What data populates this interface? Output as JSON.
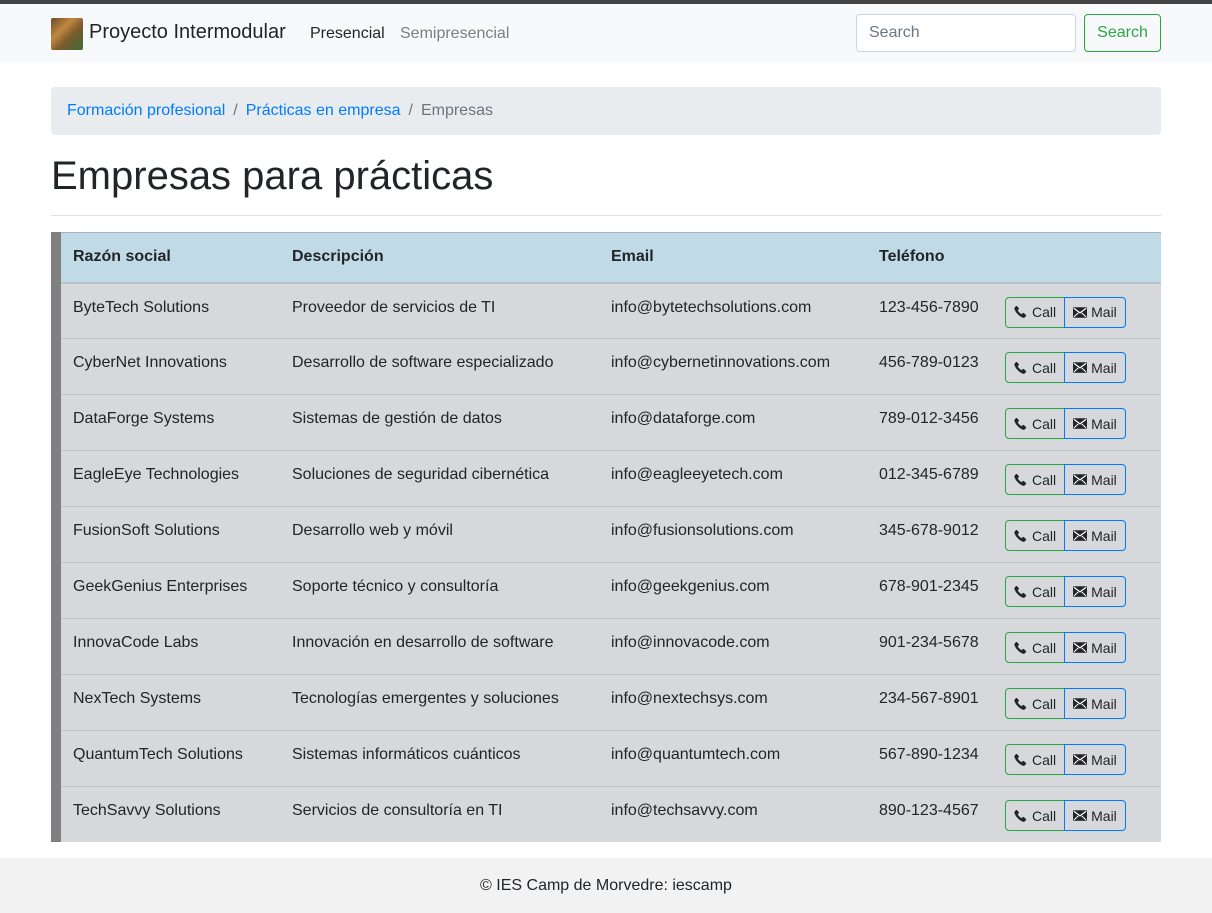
{
  "navbar": {
    "brand": "Proyecto Intermodular",
    "links": [
      "Presencial",
      "Semipresencial"
    ],
    "search_placeholder": "Search",
    "search_button": "Search"
  },
  "breadcrumb": {
    "items": [
      "Formación profesional",
      "Prácticas en empresa"
    ],
    "active": "Empresas",
    "separator": "/"
  },
  "page_title": "Empresas para prácticas",
  "table": {
    "headers": [
      "Razón social",
      "Descripción",
      "Email",
      "Teléfono"
    ],
    "call_label": "Call",
    "mail_label": "Mail",
    "rows": [
      [
        "ByteTech Solutions",
        "Proveedor de servicios de TI",
        "info@bytetechsolutions.com",
        "123-456-7890"
      ],
      [
        "CyberNet Innovations",
        "Desarrollo de software especializado",
        "info@cybernetinnovations.com",
        "456-789-0123"
      ],
      [
        "DataForge Systems",
        "Sistemas de gestión de datos",
        "info@dataforge.com",
        "789-012-3456"
      ],
      [
        "EagleEye Technologies",
        "Soluciones de seguridad cibernética",
        "info@eagleeyetech.com",
        "012-345-6789"
      ],
      [
        "FusionSoft Solutions",
        "Desarrollo web y móvil",
        "info@fusionsolutions.com",
        "345-678-9012"
      ],
      [
        "GeekGenius Enterprises",
        "Soporte técnico y consultoría",
        "info@geekgenius.com",
        "678-901-2345"
      ],
      [
        "InnovaCode Labs",
        "Innovación en desarrollo de software",
        "info@innovacode.com",
        "901-234-5678"
      ],
      [
        "NexTech Systems",
        "Tecnologías emergentes y soluciones",
        "info@nextechsys.com",
        "234-567-8901"
      ],
      [
        "QuantumTech Solutions",
        "Sistemas informáticos cuánticos",
        "info@quantumtech.com",
        "567-890-1234"
      ],
      [
        "TechSavvy Solutions",
        "Servicios de consultoría en TI",
        "info@techsavvy.com",
        "890-123-4567"
      ]
    ]
  },
  "footer": "© IES Camp de Morvedre: iescamp",
  "colors": {
    "accent_link": "#007bff",
    "success": "#28a745",
    "table_head": "#c1dbe6",
    "table_body": "#d6d8db"
  },
  "icons": {
    "call": "phone-icon",
    "mail": "envelope-icon"
  }
}
